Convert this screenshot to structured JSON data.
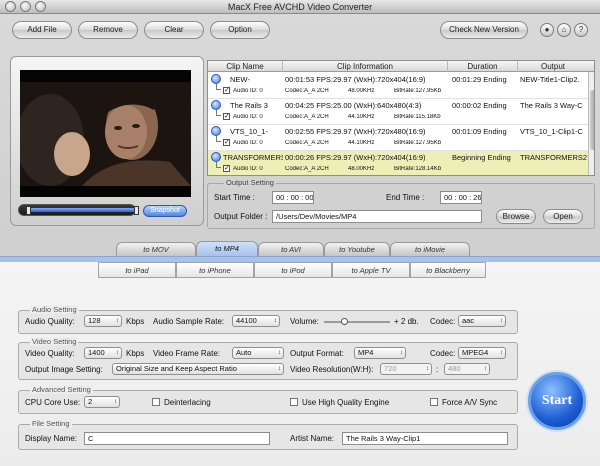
{
  "window": {
    "title": "MacX Free AVCHD Video Converter"
  },
  "toolbar": {
    "add_file": "Add File",
    "remove": "Remove",
    "clear": "Clear",
    "option": "Option",
    "check_version": "Check New Version"
  },
  "preview": {
    "snapshot": "Snapshot"
  },
  "clips": {
    "headers": {
      "name": "Clip Name",
      "info": "Clip Information",
      "duration": "Duration",
      "output": "Output"
    },
    "rows": [
      {
        "name": "NEW-",
        "info": "00:01:53  FPS:29.97  (WxH):720x404(16:9)",
        "duration": "00:01:29 Ending",
        "output": "NEW-Title1-Clip2.",
        "audio": "Audio ID: 0",
        "codec": "Codec:A_A 2CH",
        "rate": "48.00KHz",
        "bitrate": "BitRate:127.95Kb",
        "selected": false
      },
      {
        "name": "The Rails 3",
        "info": "00:04:25  FPS:25.00  (WxH):640x480(4:3)",
        "duration": "00:00:02 Ending",
        "output": "The Rails 3 Way-C",
        "audio": "Audio ID: 0",
        "codec": "Codec:A_A 2CH",
        "rate": "44.10KHz",
        "bitrate": "BitRate:115.18Kb",
        "selected": false
      },
      {
        "name": "VTS_10_1-",
        "info": "00:02:55  FPS:29.97  (WxH):720x480(16:9)",
        "duration": "00:01:09 Ending",
        "output": "VTS_10_1-Clip1-C",
        "audio": "Audio ID: 0",
        "codec": "Codec:A_A 2CH",
        "rate": "44.10KHz",
        "bitrate": "BitRate:127.95Kb",
        "selected": false
      },
      {
        "name": "TRANSFORMERS",
        "info": "00:00:26  FPS:29.97  (WxH):720x404(16:9)",
        "duration": "Beginning Ending",
        "output": "TRANSFORMERS2",
        "audio": "Audio ID: 0",
        "codec": "Codec:A_A 2CH",
        "rate": "48.00KHz",
        "bitrate": "BitRate:128.14Kb",
        "selected": true
      }
    ]
  },
  "output_setting": {
    "title": "Output Setting",
    "start_label": "Start Time :",
    "start_value": "00 : 00 : 00",
    "end_label": "End Time :",
    "end_value": "00 : 00 : 26",
    "folder_label": "Output Folder :",
    "folder_value": "/Users/Dev/Movies/MP4",
    "browse": "Browse",
    "open": "Open"
  },
  "format_tabs": [
    "to MOV",
    "to MP4",
    "to AVI",
    "to Youtube",
    "to iMovie"
  ],
  "active_format": "to MP4",
  "device_tabs": [
    "to iPad",
    "to iPhone",
    "to iPod",
    "to Apple TV",
    "to Blackberry"
  ],
  "audio": {
    "title": "Audio Setting",
    "quality_label": "Audio Quality:",
    "quality_value": "128",
    "quality_unit": "Kbps",
    "sample_label": "Audio Sample Rate:",
    "sample_value": "44100",
    "volume_label": "Volume:",
    "volume_value": "+ 2 db.",
    "volume_level": 0.3,
    "codec_label": "Codec:",
    "codec_value": "aac"
  },
  "video": {
    "title": "Video Setting",
    "quality_label": "Video Quality:",
    "quality_value": "1400",
    "quality_unit": "Kbps",
    "framerate_label": "Video Frame Rate:",
    "framerate_value": "Auto",
    "format_label": "Output Format:",
    "format_value": "MP4",
    "codec_label": "Codec:",
    "codec_value": "MPEG4",
    "image_label": "Output Image Setting:",
    "image_value": "Original Size and Keep Aspect Ratio",
    "resolution_label": "Video Resolution(W:H):",
    "res_w": "720",
    "res_sep": ":",
    "res_h": "480"
  },
  "advanced": {
    "title": "Advanced Setting",
    "cpu_label": "CPU Core Use:",
    "cpu_value": "2",
    "deinterlacing": "Deinterlacing",
    "high_quality": "Use High Quality Engine",
    "force_av": "Force A/V Sync"
  },
  "file": {
    "title": "File Setting",
    "display_label": "Display Name:",
    "display_value": "C",
    "artist_label": "Artist Name:",
    "artist_value": "The Rails 3 Way-Clip1"
  },
  "start": "Start",
  "colors": {
    "accent": "#2d6bd8",
    "selected_row": "#eeeeb7"
  }
}
